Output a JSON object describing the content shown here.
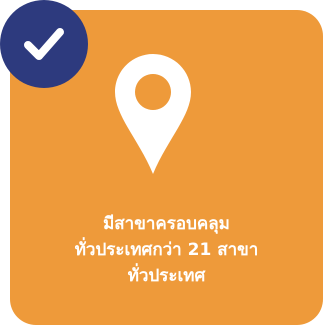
{
  "colors": {
    "card_background": "#EE9A3A",
    "badge_background": "#2D3A7E",
    "icon_color": "#FFFFFF",
    "caption_color": "#FFFFFF"
  },
  "icons": {
    "badge": "checkmark-icon",
    "main": "map-pin-icon"
  },
  "caption": {
    "line1": "มีสาขาครอบคลุม",
    "line2": "ทั่วประเทศกว่า 21 สาขา",
    "line3": "ทั่วประเทศ"
  }
}
